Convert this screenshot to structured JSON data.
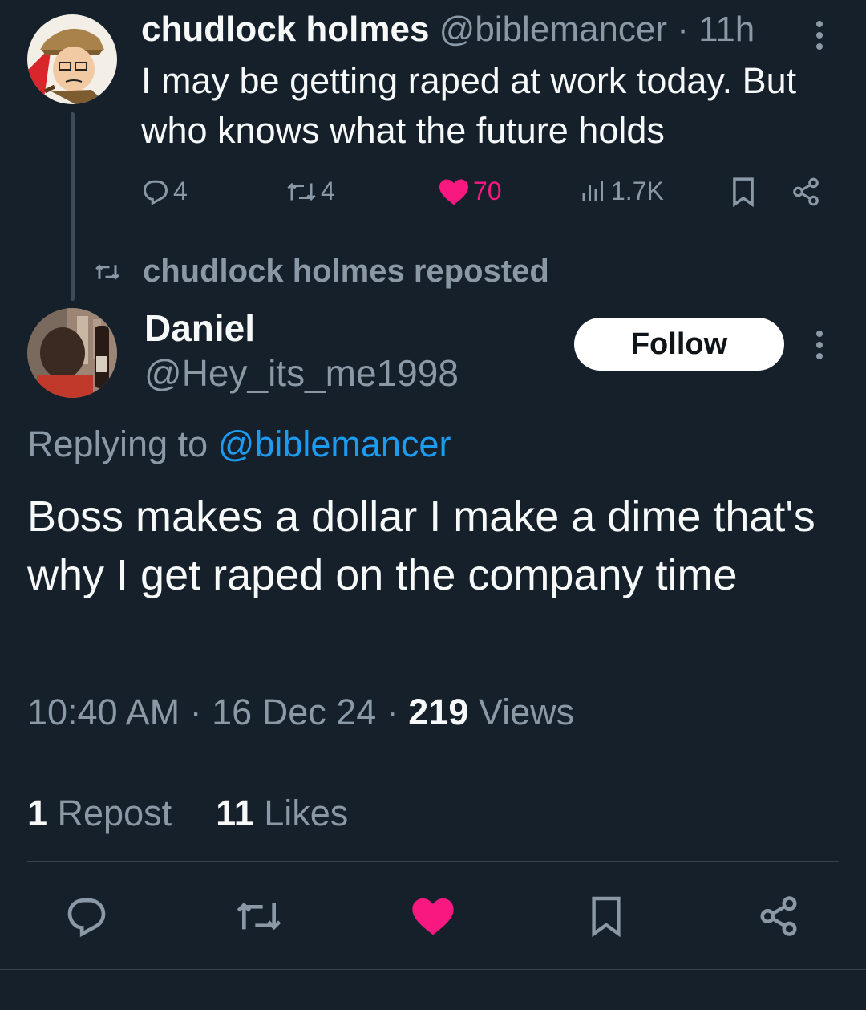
{
  "parent": {
    "name": "chudlock holmes",
    "handle": "@biblemancer",
    "time_sep": " · ",
    "time": "11h",
    "text": "I may be getting raped at work today. But who knows what the future holds",
    "replies": "4",
    "reposts": "4",
    "likes": "70",
    "views": "1.7K"
  },
  "repost_note": "chudlock holmes reposted",
  "tweet": {
    "name": "Daniel",
    "handle": "@Hey_its_me1998",
    "follow_label": "Follow",
    "replying_prefix": "Replying to ",
    "replying_to": "@biblemancer",
    "text": "Boss makes a dollar I make a dime that's why I get raped on the company time",
    "time": "10:40 AM",
    "sep1": " · ",
    "date": "16 Dec 24",
    "sep2": " · ",
    "views_count": "219",
    "views_label": " Views",
    "repost_count": "1",
    "repost_label": " Repost",
    "likes_count": "11",
    "likes_label": " Likes"
  },
  "colors": {
    "background": "#15202b",
    "text": "#f7f9f9",
    "muted": "#8b98a5",
    "link": "#1d9bf0",
    "like": "#f91880"
  },
  "icons": {
    "reply": "reply-icon",
    "repost": "repost-icon",
    "like": "heart-icon",
    "views": "views-icon",
    "bookmark": "bookmark-icon",
    "share": "share-icon",
    "more": "more-icon"
  }
}
